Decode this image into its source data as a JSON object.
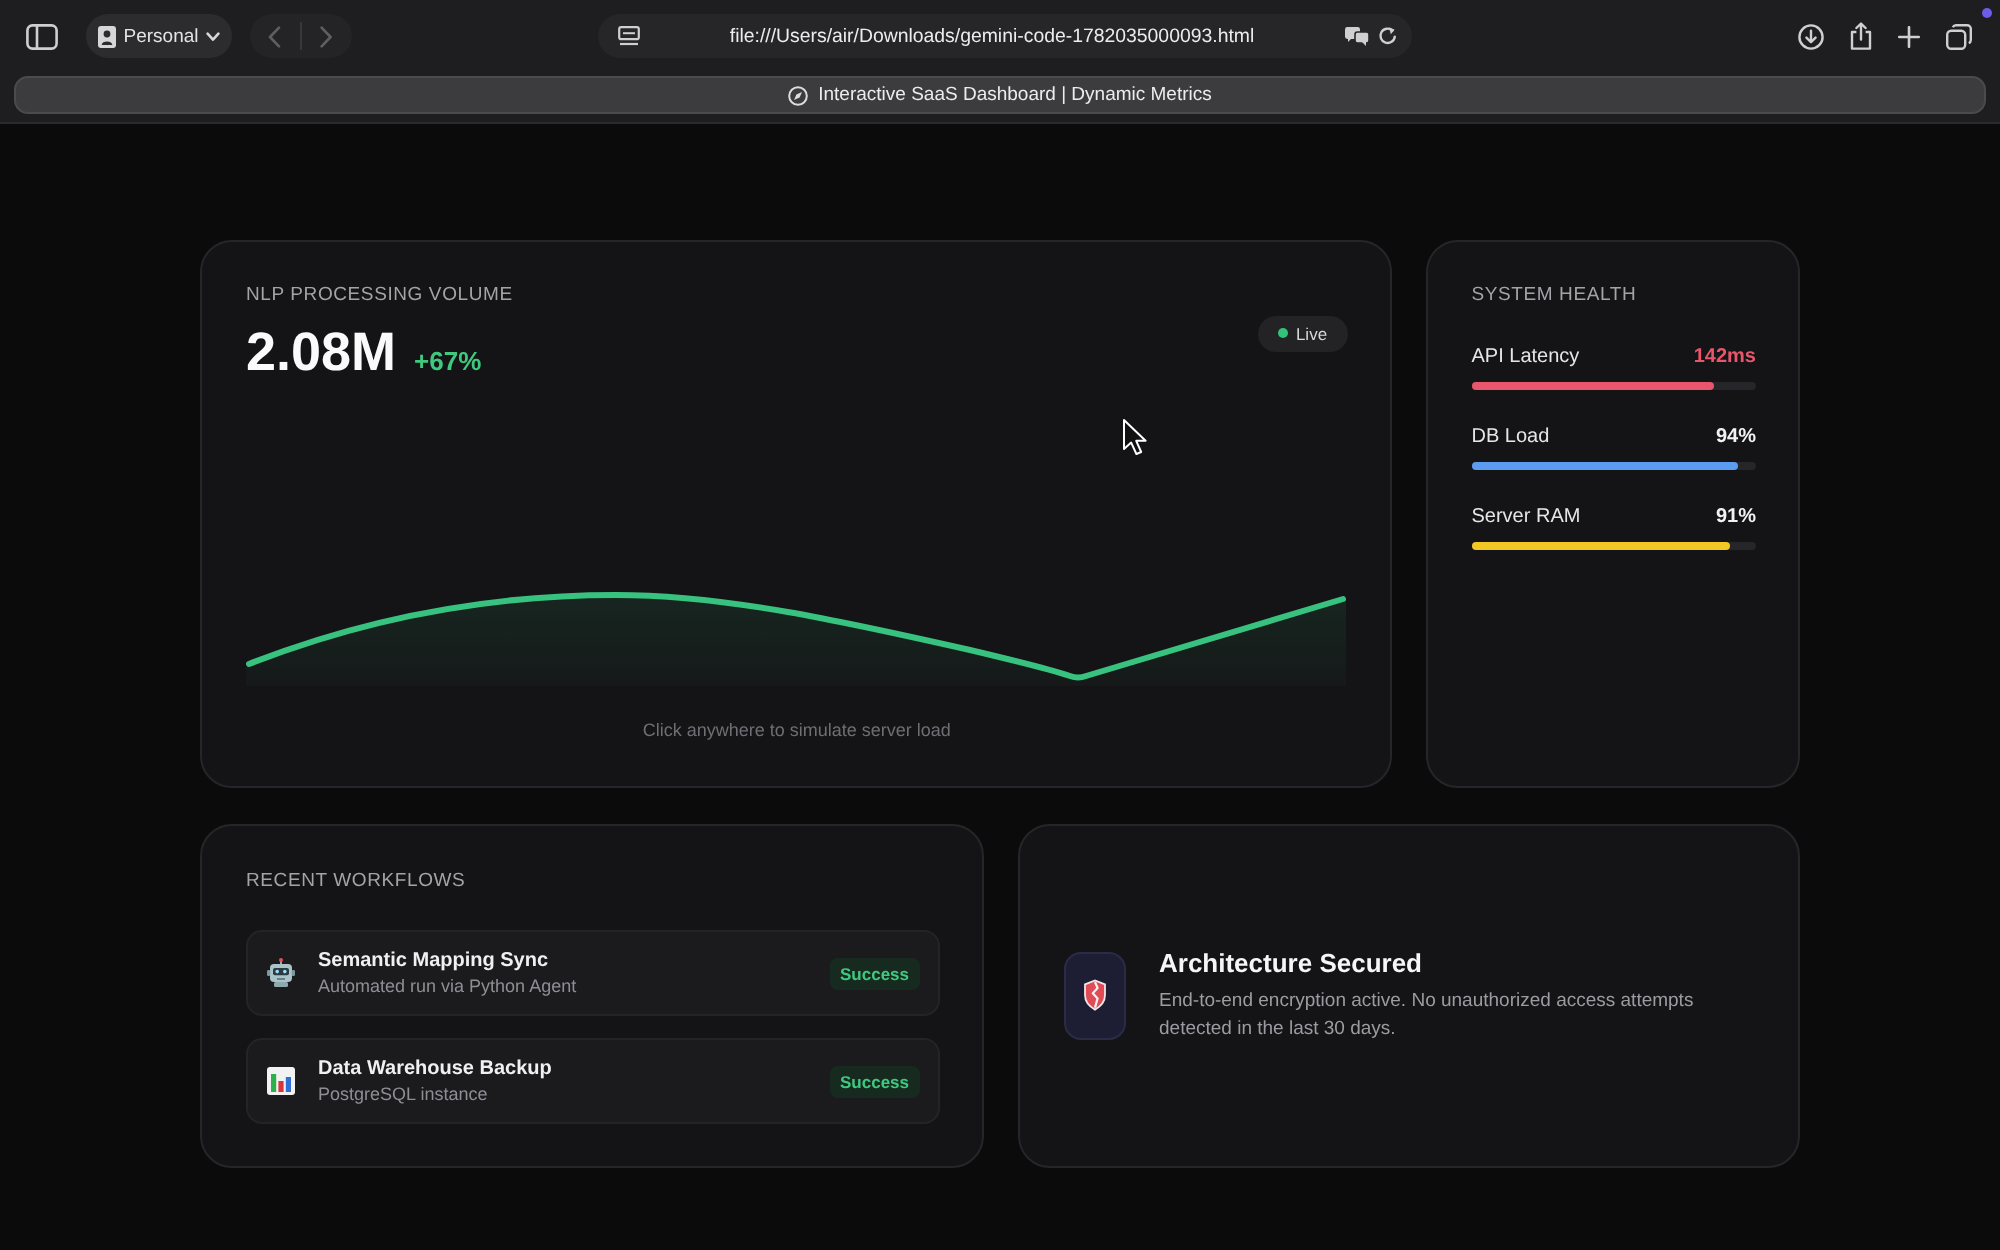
{
  "browser": {
    "profile": "Personal",
    "nav_buttons": [
      {
        "kind": "back",
        "disabled": true
      },
      {
        "kind": "forward",
        "disabled": true
      }
    ],
    "url": "file:///Users/air/Downloads/gemini-code-1782035000093.html",
    "tabs": [
      {
        "title": "Interactive SaaS Dashboard | Dynamic Metrics",
        "selected": true
      }
    ]
  },
  "volume_card": {
    "title": "NLP PROCESSING VOLUME",
    "value": "2.08M",
    "change": "+67%",
    "status": "Live",
    "hint": "Click anywhere to simulate server load"
  },
  "health_card": {
    "title": "SYSTEM HEALTH",
    "metrics": [
      {
        "name": "API Latency",
        "reading": "142ms",
        "level": 0.85,
        "color": "#e8566c",
        "alert": true
      },
      {
        "name": "DB Load",
        "reading": "94%",
        "level": 0.94,
        "color": "#5b9cf0",
        "alert": false
      },
      {
        "name": "Server RAM",
        "reading": "91%",
        "level": 0.91,
        "color": "#f2c924",
        "alert": false
      }
    ]
  },
  "workflows_card": {
    "title": "RECENT WORKFLOWS",
    "items": [
      {
        "kind": "agent",
        "name": "Semantic Mapping Sync",
        "detail": "Automated run via Python Agent",
        "status": "Success"
      },
      {
        "kind": "backup",
        "name": "Data Warehouse Backup",
        "detail": "PostgreSQL instance",
        "status": "Success"
      }
    ]
  },
  "security_card": {
    "title": "Architecture Secured",
    "text": "End-to-end encryption active. No unauthorized access attempts detected in the last 30 days."
  }
}
